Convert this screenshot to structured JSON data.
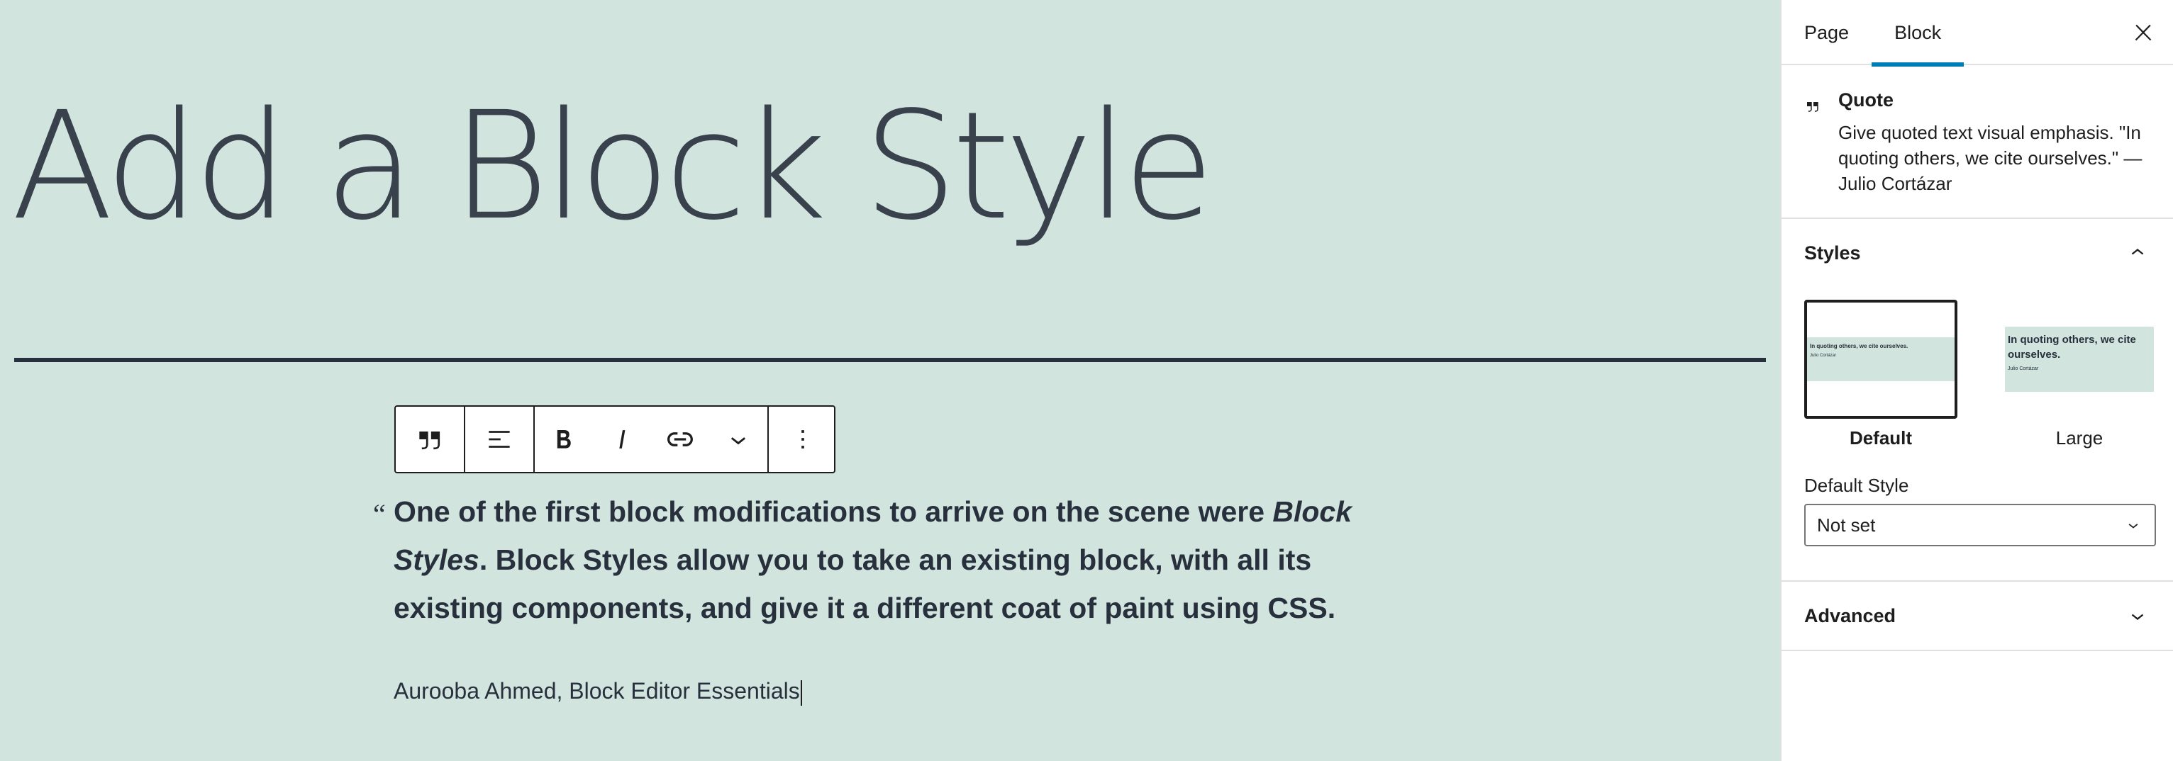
{
  "editor": {
    "title": "Add a Block Style",
    "quote": {
      "mark": "“",
      "text_part1": "One of the first block modifications to arrive on the scene were ",
      "text_em": "Block Styles",
      "text_part2": ". Block Styles allow you to take an existing block, with all its existing components, and give it a different coat of paint using CSS.",
      "citation": "Aurooba Ahmed, Block Editor Essentials"
    },
    "toolbar": [
      {
        "name": "quote-block-icon",
        "icon": "quote"
      },
      {
        "name": "align-icon",
        "icon": "align-left"
      },
      {
        "name": "bold-icon",
        "icon": "bold"
      },
      {
        "name": "italic-icon",
        "icon": "italic"
      },
      {
        "name": "link-icon",
        "icon": "link"
      },
      {
        "name": "more-rich-text-icon",
        "icon": "chevron-down"
      },
      {
        "name": "options-icon",
        "icon": "more-vertical"
      }
    ]
  },
  "sidebar": {
    "tabs": [
      {
        "label": "Page",
        "active": false
      },
      {
        "label": "Block",
        "active": true
      }
    ],
    "close_icon": "close-icon",
    "block_card": {
      "icon": "quote-icon",
      "title": "Quote",
      "description": "Give quoted text visual emphasis. \"In quoting others, we cite ourselves.\" — Julio Cortázar"
    },
    "styles_panel": {
      "title": "Styles",
      "options": [
        {
          "label": "Default",
          "selected": true,
          "preview_quote": "In quoting others, we cite ourselves.",
          "preview_cite": "Julio Cortázar"
        },
        {
          "label": "Large",
          "selected": false,
          "preview_quote": "In quoting others, we cite ourselves.",
          "preview_cite": "Julio Cortázar"
        }
      ],
      "default_style_label": "Default Style",
      "default_style_value": "Not set"
    },
    "advanced_panel": {
      "title": "Advanced"
    }
  },
  "colors": {
    "canvas_background": "#d1e4dd",
    "text": "#28303d",
    "accent": "#007cba"
  }
}
